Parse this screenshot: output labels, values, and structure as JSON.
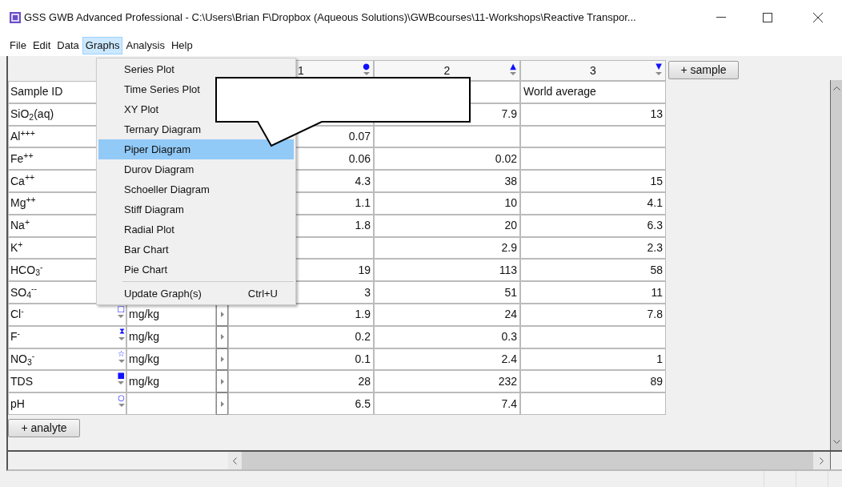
{
  "window": {
    "title": "GSS GWB Advanced Professional - C:\\Users\\Brian F\\Dropbox (Aqueous Solutions)\\GWBcourses\\11-Workshops\\Reactive Transpor..."
  },
  "menu_bar": [
    {
      "label": "File",
      "selected": false
    },
    {
      "label": "Edit",
      "selected": false
    },
    {
      "label": "Data",
      "selected": false
    },
    {
      "label": "Graphs",
      "selected": true
    },
    {
      "label": "Analysis",
      "selected": false
    },
    {
      "label": "Help",
      "selected": false
    }
  ],
  "samples": [
    {
      "label": "1",
      "marker": "●"
    },
    {
      "label": "2",
      "marker": "▲"
    },
    {
      "label": "3",
      "marker": "▼"
    }
  ],
  "add_sample_button": "+ sample",
  "rows": [
    {
      "kind": "id",
      "name": "Sample ID",
      "sample_3": "World average"
    },
    {
      "kind": "analyte",
      "name": "SiO$_{2}$(aq)",
      "sample_2": "7.9",
      "sample_3": "13"
    },
    {
      "kind": "analyte",
      "name": "Al$^{+++}$",
      "sample_1": "0.07"
    },
    {
      "kind": "analyte",
      "name": "Fe$^{++}$",
      "sample_1": "0.06",
      "sample_2": "0.02"
    },
    {
      "kind": "analyte",
      "name": "Ca$^{++}$",
      "sample_1": "4.3",
      "sample_2": "38",
      "sample_3": "15"
    },
    {
      "kind": "analyte",
      "name": "Mg$^{++}$",
      "sample_1": "1.1",
      "sample_2": "10",
      "sample_3": "4.1"
    },
    {
      "kind": "analyte",
      "name": "Na$^{+}$",
      "sample_1": "1.8",
      "sample_2": "20",
      "sample_3": "6.3"
    },
    {
      "kind": "analyte",
      "name": "K$^{+}$",
      "sample_2": "2.9",
      "sample_3": "2.3"
    },
    {
      "kind": "analyte",
      "name": "HCO$_{3}$$^{-}$",
      "sample_1": "19",
      "sample_2": "113",
      "sample_3": "58"
    },
    {
      "kind": "analyte",
      "name": "SO$_{4}$$^{--}$",
      "sample_1": "3",
      "sample_2": "51",
      "sample_3": "11"
    },
    {
      "kind": "analyte",
      "name": "Cl$^{-}$",
      "marker": "□",
      "units": "mg/kg",
      "sample_1": "1.9",
      "sample_2": "24",
      "sample_3": "7.8"
    },
    {
      "kind": "analyte",
      "name": "F$^{-}$",
      "marker": "⧗",
      "units": "mg/kg",
      "sample_1": "0.2",
      "sample_2": "0.3"
    },
    {
      "kind": "analyte",
      "name": "NO$_{3}$$^{-}$",
      "marker": "☆",
      "units": "mg/kg",
      "sample_1": "0.1",
      "sample_2": "2.4",
      "sample_3": "1"
    },
    {
      "kind": "analyte",
      "name": "TDS",
      "marker": "■",
      "units": "mg/kg",
      "sample_1": "28",
      "sample_2": "232",
      "sample_3": "89"
    },
    {
      "kind": "analyte",
      "name": "pH",
      "marker": "○",
      "sample_1": "6.5",
      "sample_2": "7.4"
    }
  ],
  "add_analyte_button": "+ analyte",
  "graphs_menu": {
    "items": [
      {
        "kind": "graph",
        "label": "Series Plot",
        "selected": false
      },
      {
        "kind": "graph",
        "label": "Time Series Plot",
        "selected": false
      },
      {
        "kind": "graph",
        "label": "XY Plot",
        "selected": false
      },
      {
        "kind": "graph",
        "label": "Ternary Diagram",
        "selected": false
      },
      {
        "kind": "graph",
        "label": "Piper Diagram",
        "selected": true
      },
      {
        "kind": "graph",
        "label": "Durov Diagram",
        "selected": false
      },
      {
        "kind": "graph",
        "label": "Schoeller Diagram",
        "selected": false
      },
      {
        "kind": "graph",
        "label": "Stiff Diagram",
        "selected": false
      },
      {
        "kind": "graph",
        "label": "Radial Plot",
        "selected": false
      },
      {
        "kind": "graph",
        "label": "Bar Chart",
        "selected": false
      },
      {
        "kind": "graph",
        "label": "Pie Chart",
        "selected": false
      },
      {
        "kind": "command",
        "label": "Update Graph(s)",
        "shortcut": "Ctrl+U",
        "selected": false
      }
    ]
  }
}
